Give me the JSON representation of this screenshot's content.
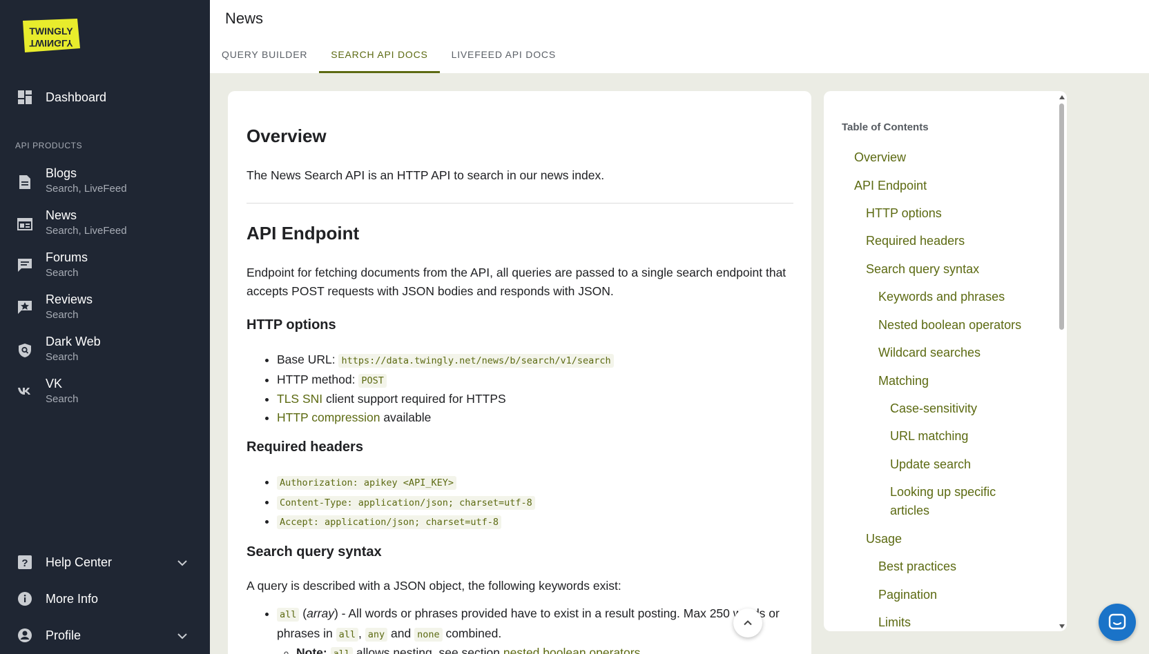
{
  "sidebar": {
    "logo_text": "TWINGLY",
    "dashboard": "Dashboard",
    "section_label": "API PRODUCTS",
    "products": [
      {
        "title": "Blogs",
        "sub": "Search, LiveFeed"
      },
      {
        "title": "News",
        "sub": "Search, LiveFeed"
      },
      {
        "title": "Forums",
        "sub": "Search"
      },
      {
        "title": "Reviews",
        "sub": "Search"
      },
      {
        "title": "Dark Web",
        "sub": "Search"
      },
      {
        "title": "VK",
        "sub": "Search"
      }
    ],
    "help_center": "Help Center",
    "more_info": "More Info",
    "profile": "Profile"
  },
  "header": {
    "title": "News",
    "tabs": [
      "QUERY BUILDER",
      "SEARCH API DOCS",
      "LIVEFEED API DOCS"
    ]
  },
  "doc": {
    "overview_title": "Overview",
    "overview_text": "The News Search API is an HTTP API to search in our news index.",
    "endpoint_title": "API Endpoint",
    "endpoint_text": "Endpoint for fetching documents from the API, all queries are passed to a single search endpoint that accepts POST requests with JSON bodies and responds with JSON.",
    "http_title": "HTTP options",
    "base_url_label": "Base URL: ",
    "base_url": "https://data.twingly.net/news/b/search/v1/search",
    "method_label": "HTTP method: ",
    "method": "POST",
    "tls_link": "TLS SNI",
    "tls_text": " client support required for HTTPS",
    "compression_link": "HTTP compression",
    "compression_text": " available",
    "headers_title": "Required headers",
    "headers": [
      "Authorization: apikey <API_KEY>",
      "Content-Type: application/json; charset=utf-8",
      "Accept: application/json; charset=utf-8"
    ],
    "syntax_title": "Search query syntax",
    "syntax_text": "A query is described with a JSON object, the following keywords exist:",
    "all_code": "all",
    "all_type": "array",
    "all_text_1": " - All words or phrases provided have to exist in a result posting. Max 250 words or phrases in ",
    "all_code2": "all",
    "any_code": "any",
    "and_text": " and ",
    "none_code": "none",
    "combined": " combined.",
    "note_label": "Note: ",
    "note_code": "all",
    "note_text": " allows nesting, see section ",
    "note_link": "nested boolean operators"
  },
  "toc": {
    "title": "Table of Contents",
    "items": [
      "Overview",
      "API Endpoint",
      "HTTP options",
      "Required headers",
      "Search query syntax",
      "Keywords and phrases",
      "Nested boolean operators",
      "Wildcard searches",
      "Matching",
      "Case-sensitivity",
      "URL matching",
      "Update search",
      "Looking up specific articles",
      "Usage",
      "Best practices",
      "Pagination",
      "Limits"
    ]
  },
  "colors": {
    "sidebar_bg": "#1f2633",
    "accent": "#5c6a12",
    "logo_yellow": "#e8ec2c",
    "chat_blue": "#1a73c8"
  }
}
